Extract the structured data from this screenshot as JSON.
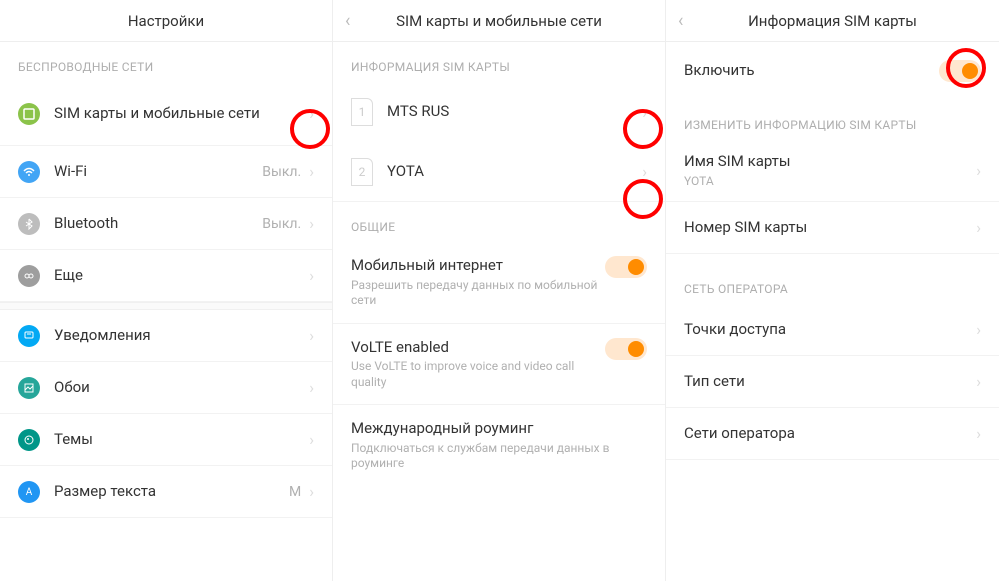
{
  "panel1": {
    "title": "Настройки",
    "section1": "БЕСПРОВОДНЫЕ СЕТИ",
    "rows": {
      "sim": "SIM карты и мобильные сети",
      "wifi": "Wi-Fi",
      "wifi_val": "Выкл.",
      "bt": "Bluetooth",
      "bt_val": "Выкл.",
      "more": "Еще",
      "notif": "Уведомления",
      "wall": "Обои",
      "themes": "Темы",
      "text": "Размер текста",
      "text_val": "M"
    }
  },
  "panel2": {
    "title": "SIM карты и мобильные сети",
    "section1": "ИНФОРМАЦИЯ SIM КАРТЫ",
    "sim1": "MTS RUS",
    "sim1_num": "1",
    "sim2": "YOTA",
    "sim2_num": "2",
    "section2": "ОБЩИЕ",
    "mobdata": "Мобильный интернет",
    "mobdata_sub": "Разрешить передачу данных по мобильной сети",
    "volte": "VoLTE enabled",
    "volte_sub": "Use VoLTE to improve voice and video call quality",
    "roaming": "Международный роуминг",
    "roaming_sub": "Подключаться к службам передачи данных в роуминге"
  },
  "panel3": {
    "title": "Информация SIM карты",
    "enable": "Включить",
    "section1": "ИЗМЕНИТЬ ИНФОРМАЦИЮ SIM КАРТЫ",
    "name": "Имя SIM карты",
    "name_val": "YOTA",
    "number": "Номер SIM карты",
    "section2": "СЕТЬ ОПЕРАТОРА",
    "apn": "Точки доступа",
    "nettype": "Тип сети",
    "opnet": "Сети оператора"
  }
}
